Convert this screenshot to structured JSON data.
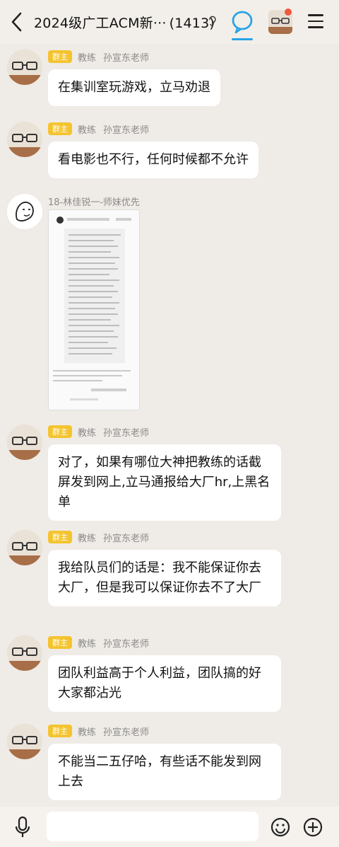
{
  "header": {
    "title": "2024级广工ACM新···",
    "member_count": "(1413)"
  },
  "messages": [
    {
      "badge": "群主",
      "role": "教练",
      "name": "孙宣东老师",
      "text": "在集训室玩游戏，立马劝退"
    },
    {
      "badge": "群主",
      "role": "教练",
      "name": "孙宣东老师",
      "text": "看电影也不行，任何时候都不允许"
    },
    {
      "name": "18-林佳锐一-师妹优先"
    },
    {
      "badge": "群主",
      "role": "教练",
      "name": "孙宣东老师",
      "text": "对了，如果有哪位大神把教练的话截屏发到网上,立马通报给大厂hr,上黑名单"
    },
    {
      "badge": "群主",
      "role": "教练",
      "name": "孙宣东老师",
      "text": "我给队员们的话是：我不能保证你去大厂，但是我可以保证你去不了大厂"
    },
    {
      "badge": "群主",
      "role": "教练",
      "name": "孙宣东老师",
      "text": "团队利益高于个人利益，团队搞的好大家都沾光"
    },
    {
      "badge": "群主",
      "role": "教练",
      "name": "孙宣东老师",
      "text": "不能当二五仔哈，有些话不能发到网上去"
    }
  ],
  "icons": {
    "back": "chevron-left-icon",
    "ear": "ear-icon",
    "chat": "chat-bubble-icon",
    "menu": "menu-icon",
    "mic": "microphone-icon",
    "emoji": "emoji-icon",
    "plus": "plus-icon"
  },
  "colors": {
    "accent": "#2aa3e6",
    "badge": "#f4c430",
    "notification": "#f0573c"
  }
}
